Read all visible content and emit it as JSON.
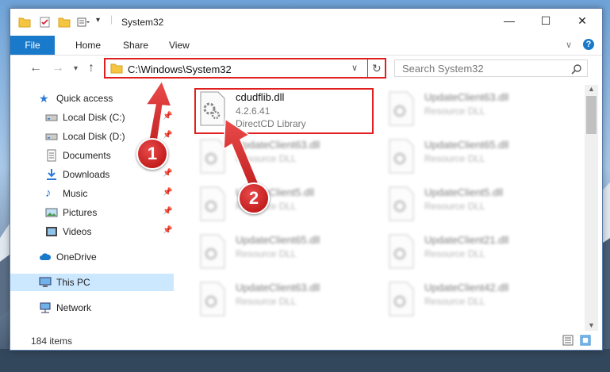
{
  "window": {
    "title": "System32",
    "controls": {
      "minimize": "—",
      "maximize": "☐",
      "close": "✕"
    }
  },
  "ribbon": {
    "tabs": [
      "File",
      "Home",
      "Share",
      "View"
    ],
    "help": "?",
    "expand": "∨"
  },
  "address": {
    "path": "C:\\Windows\\System32",
    "search_placeholder": "Search System32"
  },
  "nav": {
    "quick_access": "Quick access",
    "items": [
      {
        "label": "Local Disk (C:)",
        "icon": "drive-icon"
      },
      {
        "label": "Local Disk (D:)",
        "icon": "drive-icon"
      },
      {
        "label": "Documents",
        "icon": "documents-icon"
      },
      {
        "label": "Downloads",
        "icon": "downloads-icon"
      },
      {
        "label": "Music",
        "icon": "music-icon"
      },
      {
        "label": "Pictures",
        "icon": "pictures-icon"
      },
      {
        "label": "Videos",
        "icon": "videos-icon"
      }
    ],
    "onedrive": "OneDrive",
    "this_pc": "This PC",
    "network": "Network"
  },
  "files": {
    "highlighted": {
      "name": "cdudflib.dll",
      "version": "4.2.6.41",
      "description": "DirectCD Library"
    },
    "others": [
      {
        "name": "UpdateClient63.dll",
        "type": "Resource DLL"
      },
      {
        "name": "UpdateClient63.dll",
        "type": "Resource DLL"
      },
      {
        "name": "UpdateClient65.dll",
        "type": "Resource DLL"
      },
      {
        "name": "UpdateClient5.dll",
        "type": "Resource DLL"
      },
      {
        "name": "UpdateClient5.dll",
        "type": "Resource DLL"
      },
      {
        "name": "UpdateClient65.dll",
        "type": "Resource DLL"
      },
      {
        "name": "UpdateClient21.dll",
        "type": "Resource DLL"
      },
      {
        "name": "UpdateClient63.dll",
        "type": "Resource DLL"
      },
      {
        "name": "UpdateClient42.dll",
        "type": "Resource DLL"
      }
    ]
  },
  "status": {
    "item_count": "184 items"
  },
  "annotations": {
    "step1": "1",
    "step2": "2"
  },
  "colors": {
    "accent": "#1979ca",
    "highlight": "#e02020",
    "selected_nav": "#cce8ff"
  }
}
